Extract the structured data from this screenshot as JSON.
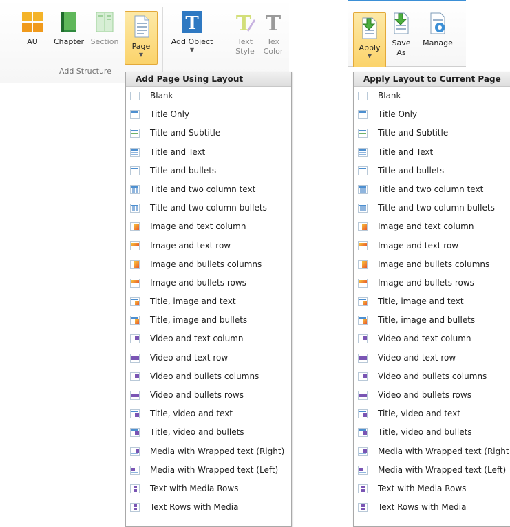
{
  "ribbon_left": {
    "buttons": [
      {
        "label": "AU",
        "icon": "au-grid-icon",
        "disabled": false
      },
      {
        "label": "Chapter",
        "icon": "chapter-book-icon",
        "disabled": false
      },
      {
        "label": "Section",
        "icon": "section-book-icon",
        "disabled": true
      },
      {
        "label": "Page",
        "icon": "page-document-icon",
        "disabled": false,
        "active": true
      },
      {
        "label": "Add Object",
        "icon": "text-object-icon",
        "disabled": false
      },
      {
        "label": "Text Style",
        "label_line1": "Text",
        "label_line2": "Style",
        "icon": "text-style-icon",
        "disabled": true
      },
      {
        "label": "Tex Color",
        "label_line1": "Tex",
        "label_line2": "Color",
        "icon": "text-color-icon",
        "disabled": true
      }
    ],
    "group_label": "Add Structure"
  },
  "ribbon_right": {
    "buttons": [
      {
        "label": "Apply",
        "icon": "apply-layout-icon",
        "active": true
      },
      {
        "label_line1": "Save",
        "label_line2": "As",
        "icon": "save-as-layout-icon"
      },
      {
        "label": "Manage",
        "icon": "manage-layout-icon"
      }
    ]
  },
  "menu_left": {
    "title": "Add Page Using Layout",
    "items": [
      "Blank",
      "Title Only",
      "Title and Subtitle",
      "Title and Text",
      "Title and bullets",
      "Title and two column text",
      "Title and two column bullets",
      "Image and text column",
      "Image and text row",
      "Image and bullets columns",
      "Image and bullets rows",
      "Title, image and text",
      "Title, image and bullets",
      "Video and text column",
      "Video and text row",
      "Video and bullets columns",
      "Video and bullets rows",
      "Title, video and text",
      "Title, video and bullets",
      "Media with Wrapped text (Right)",
      "Media with Wrapped text (Left)",
      "Text with Media Rows",
      "Text Rows with Media"
    ]
  },
  "menu_right": {
    "title": "Apply Layout to Current Page",
    "items": [
      "Blank",
      "Title Only",
      "Title and Subtitle",
      "Title and Text",
      "Title and bullets",
      "Title and two column text",
      "Title and two column bullets",
      "Image and text column",
      "Image and text row",
      "Image and bullets columns",
      "Image and bullets rows",
      "Title, image and text",
      "Title, image and bullets",
      "Video and text column",
      "Video and text row",
      "Video and bullets columns",
      "Video and bullets rows",
      "Title, video and text",
      "Title, video and bullets",
      "Media with Wrapped text (Right",
      "Media with Wrapped text (Left)",
      "Text with Media Rows",
      "Text Rows with Media"
    ]
  },
  "colors": {
    "active_bg": "#fbd36b",
    "accent_blue": "#3b8fd6",
    "menu_border": "#a9a9a9"
  }
}
